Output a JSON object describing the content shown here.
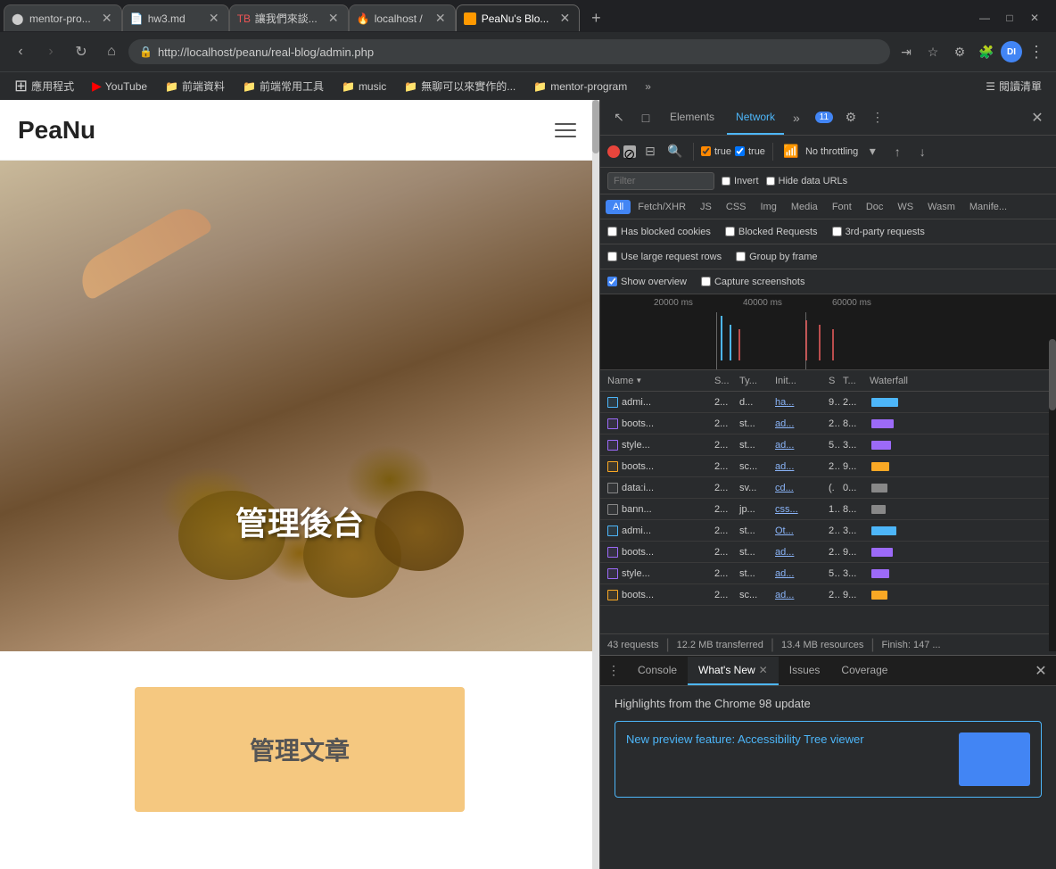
{
  "window": {
    "controls": [
      "—",
      "□",
      "✕"
    ]
  },
  "tabs": [
    {
      "id": "tab1",
      "favicon": "github",
      "title": "mentor-pro...",
      "active": false
    },
    {
      "id": "tab2",
      "favicon": "page",
      "title": "hw3.md",
      "active": false
    },
    {
      "id": "tab3",
      "favicon": "tb",
      "title": "讓我們來談...",
      "active": false
    },
    {
      "id": "tab4",
      "favicon": "fire",
      "title": "localhost /",
      "active": false
    },
    {
      "id": "tab5",
      "favicon": "peanu",
      "title": "PeaNu's Blo...",
      "active": true
    }
  ],
  "address_bar": {
    "url": "http://localhost/peanu/real-blog/admin.php",
    "back_disabled": false,
    "forward_disabled": true
  },
  "bookmarks": [
    {
      "icon": "apps",
      "label": "應用程式"
    },
    {
      "icon": "youtube",
      "label": "YouTube"
    },
    {
      "icon": "folder",
      "label": "前端資料"
    },
    {
      "icon": "folder",
      "label": "前端常用工具"
    },
    {
      "icon": "folder",
      "label": "music"
    },
    {
      "icon": "folder",
      "label": "無聊可以來實作的..."
    },
    {
      "icon": "folder",
      "label": "mentor-program"
    }
  ],
  "reading_list": "閱讀清單",
  "webpage": {
    "logo": "PeaNu",
    "hero_text": "管理後台",
    "admin_card_text": "管理文章"
  },
  "devtools": {
    "tabs": [
      "Elements",
      "Network",
      "»"
    ],
    "active_tab": "Network",
    "badge_count": "11",
    "network": {
      "recording": true,
      "preserve_log": true,
      "disable_cache": true,
      "throttling": "No throttling",
      "filter": "Filter",
      "invert": "Invert",
      "hide_data_urls": "Hide data URLs",
      "type_filters": [
        "All",
        "Fetch/XHR",
        "JS",
        "CSS",
        "Img",
        "Media",
        "Font",
        "Doc",
        "WS",
        "Wasm",
        "Manife..."
      ],
      "active_type": "All",
      "checkboxes1": [
        {
          "label": "Has blocked cookies",
          "checked": false
        },
        {
          "label": "Blocked Requests",
          "checked": false
        },
        {
          "label": "3rd-party requests",
          "checked": false
        }
      ],
      "checkboxes2": [
        {
          "label": "Use large request rows",
          "checked": false
        },
        {
          "label": "Group by frame",
          "checked": false
        }
      ],
      "checkboxes3": [
        {
          "label": "Show overview",
          "checked": true
        },
        {
          "label": "Capture screenshots",
          "checked": false
        }
      ],
      "timeline_labels": [
        "20000 ms",
        "40000 ms",
        "60000 ms"
      ],
      "table_headers": [
        "Name",
        "S...",
        "Ty...",
        "Init...",
        "S",
        "T...",
        "Waterfall"
      ],
      "rows": [
        {
          "icon": "blue",
          "name": "admi...",
          "status": "2...",
          "type": "d...",
          "initiator": "ha...",
          "s": "9.",
          "t": "2...",
          "waterfall": 85
        },
        {
          "icon": "purple",
          "name": "boots...",
          "status": "2...",
          "type": "st...",
          "initiator": "ad...",
          "s": "2.",
          "t": "8...",
          "waterfall": 80
        },
        {
          "icon": "purple",
          "name": "style...",
          "status": "2...",
          "type": "st...",
          "initiator": "ad...",
          "s": "5.",
          "t": "3...",
          "waterfall": 75
        },
        {
          "icon": "orange",
          "name": "boots...",
          "status": "2...",
          "type": "sc...",
          "initiator": "ad...",
          "s": "2.",
          "t": "9...",
          "waterfall": 70
        },
        {
          "icon": "gray",
          "name": "data:i...",
          "status": "2...",
          "type": "sv...",
          "initiator": "cd...",
          "s": "(.",
          "t": "0...",
          "waterfall": 65
        },
        {
          "icon": "gray",
          "name": "bann...",
          "status": "2...",
          "type": "jp...",
          "initiator": "css...",
          "s": "1.",
          "t": "8...",
          "waterfall": 60
        },
        {
          "icon": "blue",
          "name": "admi...",
          "status": "2...",
          "type": "st...",
          "initiator": "Ot...",
          "s": "2.",
          "t": "3...",
          "waterfall": 55
        },
        {
          "icon": "purple",
          "name": "boots...",
          "status": "2...",
          "type": "st...",
          "initiator": "ad...",
          "s": "2.",
          "t": "9...",
          "waterfall": 50
        },
        {
          "icon": "purple",
          "name": "style...",
          "status": "2...",
          "type": "st...",
          "initiator": "ad...",
          "s": "5.",
          "t": "3...",
          "waterfall": 45
        },
        {
          "icon": "orange",
          "name": "boots...",
          "status": "2...",
          "type": "sc...",
          "initiator": "ad...",
          "s": "2.",
          "t": "9...",
          "waterfall": 40
        }
      ],
      "status": {
        "requests": "43 requests",
        "transferred": "12.2 MB transferred",
        "resources": "13.4 MB resources",
        "finish": "Finish: 147 ..."
      }
    }
  },
  "bottom_panel": {
    "tabs": [
      "Console",
      "What's New",
      "Issues",
      "Coverage"
    ],
    "active_tab": "What's New",
    "highlights_title": "Highlights from the Chrome 98 update",
    "feature_title": "New preview feature: Accessibility Tree viewer"
  }
}
